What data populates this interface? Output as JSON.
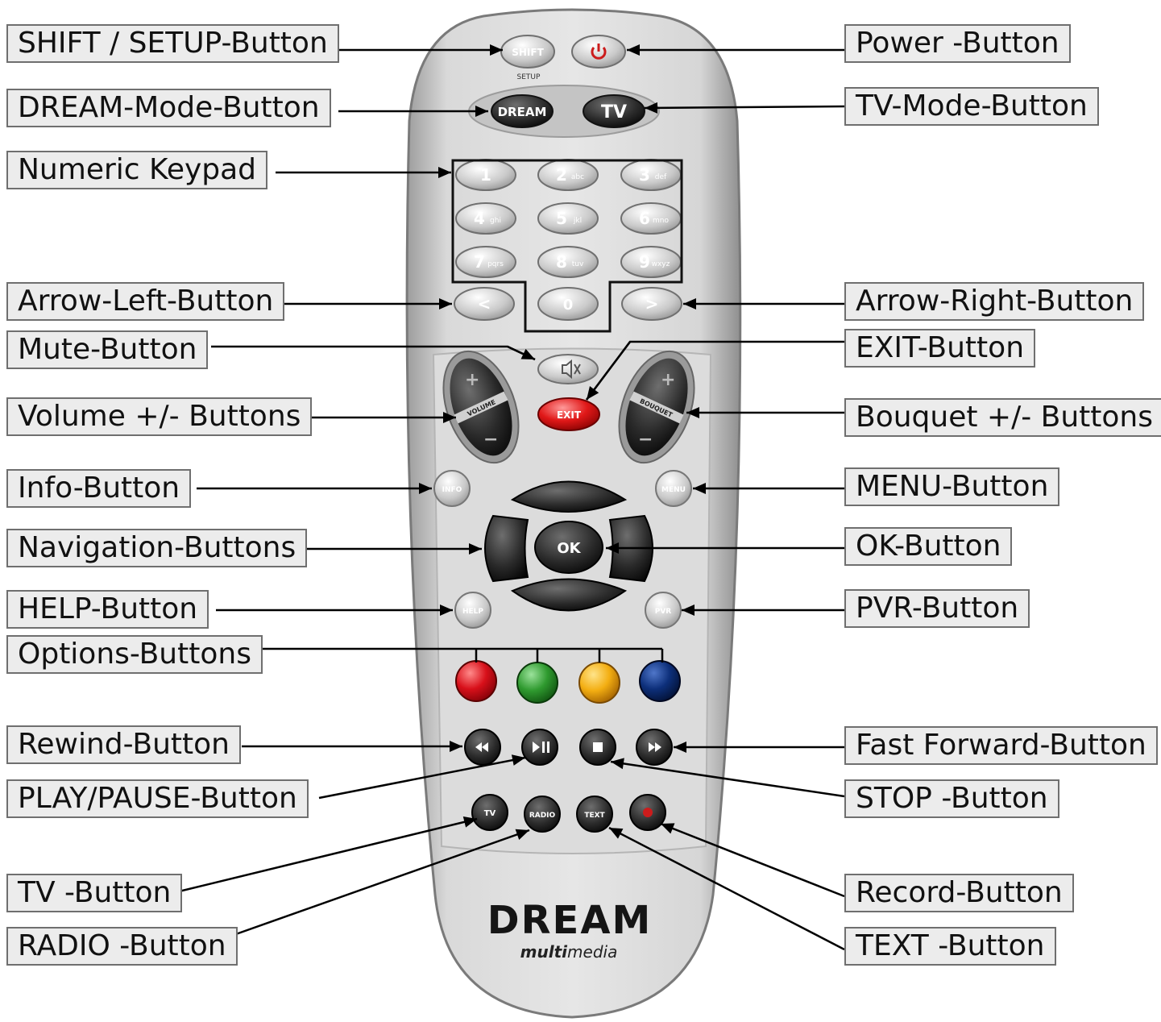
{
  "callouts": {
    "shift_setup": "SHIFT / SETUP-Button",
    "dream_mode": "DREAM-Mode-Button",
    "numeric_keypad": "Numeric Keypad",
    "arrow_left": "Arrow-Left-Button",
    "mute": "Mute-Button",
    "volume": "Volume +/- Buttons",
    "info": "Info-Button",
    "navigation": "Navigation-Buttons",
    "help": "HELP-Button",
    "options": "Options-Buttons",
    "rewind": "Rewind-Button",
    "play_pause": "PLAY/PAUSE-Button",
    "tv": "TV -Button",
    "radio": "RADIO -Button",
    "power": "Power -Button",
    "tv_mode": "TV-Mode-Button",
    "arrow_right": "Arrow-Right-Button",
    "exit": "EXIT-Button",
    "bouquet": "Bouquet +/- Buttons",
    "menu": "MENU-Button",
    "ok": "OK-Button",
    "pvr": "PVR-Button",
    "fast_forward": "Fast Forward-Button",
    "stop": "STOP -Button",
    "record": "Record-Button",
    "text": "TEXT -Button"
  },
  "remote": {
    "shift_label": "SHIFT",
    "setup_label": "SETUP",
    "dream_label": "DREAM",
    "tv_mode_label": "TV",
    "keys": [
      {
        "num": "1",
        "sub": ""
      },
      {
        "num": "2",
        "sub": "abc"
      },
      {
        "num": "3",
        "sub": "def"
      },
      {
        "num": "4",
        "sub": "ghi"
      },
      {
        "num": "5",
        "sub": "jkl"
      },
      {
        "num": "6",
        "sub": "mno"
      },
      {
        "num": "7",
        "sub": "pqrs"
      },
      {
        "num": "8",
        "sub": "tuv"
      },
      {
        "num": "9",
        "sub": "wxyz"
      }
    ],
    "arrow_left_label": "<",
    "zero_label": "0",
    "arrow_right_label": ">",
    "exit_label": "EXIT",
    "volume_label": "VOLUME",
    "bouquet_label": "BOUQUET",
    "info_label": "INFO",
    "menu_label": "MENU",
    "ok_label": "OK",
    "help_label": "HELP",
    "pvr_label": "PVR",
    "tv_label": "TV",
    "radio_label": "RADIO",
    "text_label": "TEXT",
    "brand": "DREAM",
    "brand_sub_bold": "multi",
    "brand_sub_rest": "media",
    "colors": {
      "body": "#d4d4d4",
      "red": "#d8101a",
      "green": "#2f9a2f",
      "yellow": "#f3ae12",
      "blue": "#0d2f7a",
      "power": "#cc1c1c"
    }
  }
}
